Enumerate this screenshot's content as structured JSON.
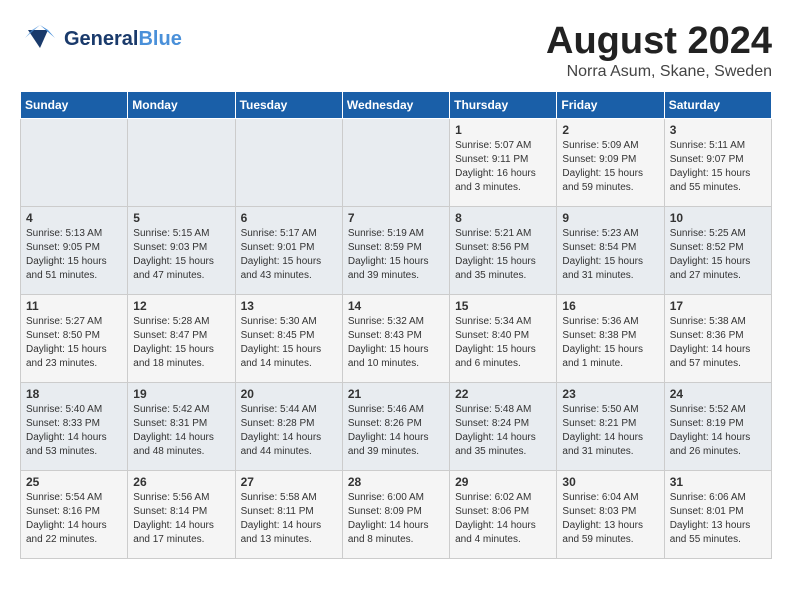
{
  "logo": {
    "text1": "General",
    "text2": "Blue"
  },
  "title": "August 2024",
  "location": "Norra Asum, Skane, Sweden",
  "days_of_week": [
    "Sunday",
    "Monday",
    "Tuesday",
    "Wednesday",
    "Thursday",
    "Friday",
    "Saturday"
  ],
  "weeks": [
    [
      {
        "day": "",
        "info": ""
      },
      {
        "day": "",
        "info": ""
      },
      {
        "day": "",
        "info": ""
      },
      {
        "day": "",
        "info": ""
      },
      {
        "day": "1",
        "info": "Sunrise: 5:07 AM\nSunset: 9:11 PM\nDaylight: 16 hours\nand 3 minutes."
      },
      {
        "day": "2",
        "info": "Sunrise: 5:09 AM\nSunset: 9:09 PM\nDaylight: 15 hours\nand 59 minutes."
      },
      {
        "day": "3",
        "info": "Sunrise: 5:11 AM\nSunset: 9:07 PM\nDaylight: 15 hours\nand 55 minutes."
      }
    ],
    [
      {
        "day": "4",
        "info": "Sunrise: 5:13 AM\nSunset: 9:05 PM\nDaylight: 15 hours\nand 51 minutes."
      },
      {
        "day": "5",
        "info": "Sunrise: 5:15 AM\nSunset: 9:03 PM\nDaylight: 15 hours\nand 47 minutes."
      },
      {
        "day": "6",
        "info": "Sunrise: 5:17 AM\nSunset: 9:01 PM\nDaylight: 15 hours\nand 43 minutes."
      },
      {
        "day": "7",
        "info": "Sunrise: 5:19 AM\nSunset: 8:59 PM\nDaylight: 15 hours\nand 39 minutes."
      },
      {
        "day": "8",
        "info": "Sunrise: 5:21 AM\nSunset: 8:56 PM\nDaylight: 15 hours\nand 35 minutes."
      },
      {
        "day": "9",
        "info": "Sunrise: 5:23 AM\nSunset: 8:54 PM\nDaylight: 15 hours\nand 31 minutes."
      },
      {
        "day": "10",
        "info": "Sunrise: 5:25 AM\nSunset: 8:52 PM\nDaylight: 15 hours\nand 27 minutes."
      }
    ],
    [
      {
        "day": "11",
        "info": "Sunrise: 5:27 AM\nSunset: 8:50 PM\nDaylight: 15 hours\nand 23 minutes."
      },
      {
        "day": "12",
        "info": "Sunrise: 5:28 AM\nSunset: 8:47 PM\nDaylight: 15 hours\nand 18 minutes."
      },
      {
        "day": "13",
        "info": "Sunrise: 5:30 AM\nSunset: 8:45 PM\nDaylight: 15 hours\nand 14 minutes."
      },
      {
        "day": "14",
        "info": "Sunrise: 5:32 AM\nSunset: 8:43 PM\nDaylight: 15 hours\nand 10 minutes."
      },
      {
        "day": "15",
        "info": "Sunrise: 5:34 AM\nSunset: 8:40 PM\nDaylight: 15 hours\nand 6 minutes."
      },
      {
        "day": "16",
        "info": "Sunrise: 5:36 AM\nSunset: 8:38 PM\nDaylight: 15 hours\nand 1 minute."
      },
      {
        "day": "17",
        "info": "Sunrise: 5:38 AM\nSunset: 8:36 PM\nDaylight: 14 hours\nand 57 minutes."
      }
    ],
    [
      {
        "day": "18",
        "info": "Sunrise: 5:40 AM\nSunset: 8:33 PM\nDaylight: 14 hours\nand 53 minutes."
      },
      {
        "day": "19",
        "info": "Sunrise: 5:42 AM\nSunset: 8:31 PM\nDaylight: 14 hours\nand 48 minutes."
      },
      {
        "day": "20",
        "info": "Sunrise: 5:44 AM\nSunset: 8:28 PM\nDaylight: 14 hours\nand 44 minutes."
      },
      {
        "day": "21",
        "info": "Sunrise: 5:46 AM\nSunset: 8:26 PM\nDaylight: 14 hours\nand 39 minutes."
      },
      {
        "day": "22",
        "info": "Sunrise: 5:48 AM\nSunset: 8:24 PM\nDaylight: 14 hours\nand 35 minutes."
      },
      {
        "day": "23",
        "info": "Sunrise: 5:50 AM\nSunset: 8:21 PM\nDaylight: 14 hours\nand 31 minutes."
      },
      {
        "day": "24",
        "info": "Sunrise: 5:52 AM\nSunset: 8:19 PM\nDaylight: 14 hours\nand 26 minutes."
      }
    ],
    [
      {
        "day": "25",
        "info": "Sunrise: 5:54 AM\nSunset: 8:16 PM\nDaylight: 14 hours\nand 22 minutes."
      },
      {
        "day": "26",
        "info": "Sunrise: 5:56 AM\nSunset: 8:14 PM\nDaylight: 14 hours\nand 17 minutes."
      },
      {
        "day": "27",
        "info": "Sunrise: 5:58 AM\nSunset: 8:11 PM\nDaylight: 14 hours\nand 13 minutes."
      },
      {
        "day": "28",
        "info": "Sunrise: 6:00 AM\nSunset: 8:09 PM\nDaylight: 14 hours\nand 8 minutes."
      },
      {
        "day": "29",
        "info": "Sunrise: 6:02 AM\nSunset: 8:06 PM\nDaylight: 14 hours\nand 4 minutes."
      },
      {
        "day": "30",
        "info": "Sunrise: 6:04 AM\nSunset: 8:03 PM\nDaylight: 13 hours\nand 59 minutes."
      },
      {
        "day": "31",
        "info": "Sunrise: 6:06 AM\nSunset: 8:01 PM\nDaylight: 13 hours\nand 55 minutes."
      }
    ]
  ]
}
